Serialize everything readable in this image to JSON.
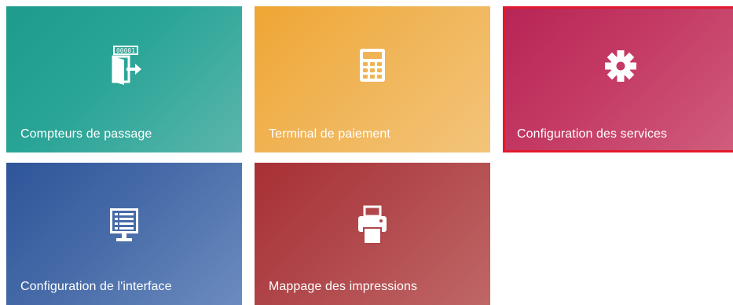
{
  "tiles": [
    {
      "label": "Compteurs de passage",
      "icon": "counter-exit-icon",
      "color": "#2aa597"
    },
    {
      "label": "Terminal de paiement",
      "icon": "calculator-icon",
      "color": "#f0b456"
    },
    {
      "label": "Configuration des services",
      "icon": "gear-icon",
      "color": "#c43a64",
      "selected": true,
      "selected_border": "#e2192d"
    },
    {
      "label": "Configuration de l'interface",
      "icon": "monitor-list-icon",
      "color": "#476ba8"
    },
    {
      "label": "Mappage des impressions",
      "icon": "printer-icon",
      "color": "#b0474b"
    }
  ],
  "counter_display_text": "00001"
}
